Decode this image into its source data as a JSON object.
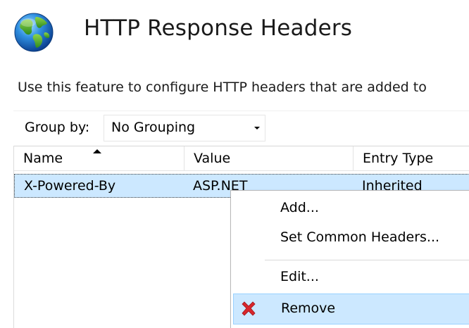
{
  "header": {
    "title": "HTTP Response Headers",
    "icon": "globe-icon",
    "description": "Use this feature to configure HTTP headers that are added to"
  },
  "toolbar": {
    "group_by_label": "Group by:",
    "group_by_value": "No Grouping"
  },
  "table": {
    "columns": [
      "Name",
      "Value",
      "Entry Type"
    ],
    "sort_column": "Name",
    "sort_direction": "ascending",
    "rows": [
      {
        "name": "X-Powered-By",
        "value": "ASP.NET",
        "entry_type": "Inherited",
        "selected": true
      }
    ]
  },
  "context_menu": {
    "items": [
      {
        "label": "Add..."
      },
      {
        "label": "Set Common Headers..."
      },
      {
        "label": "Edit..."
      },
      {
        "label": "Remove",
        "icon": "remove-icon",
        "highlighted": true
      }
    ]
  },
  "colors": {
    "selection": "#cce8ff",
    "selection_border": "#99d1ff",
    "remove_icon": "#d9262b"
  }
}
